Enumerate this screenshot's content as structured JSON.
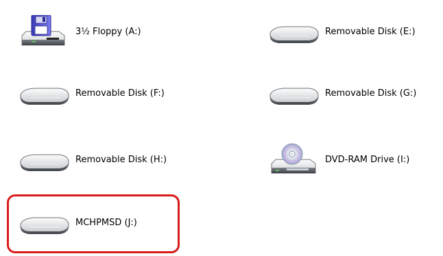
{
  "drives": [
    {
      "id": "a",
      "label": "3½ Floppy (A:)",
      "icon": "floppy-drive-icon"
    },
    {
      "id": "e",
      "label": "Removable Disk (E:)",
      "icon": "removable-disk-icon"
    },
    {
      "id": "f",
      "label": "Removable Disk (F:)",
      "icon": "removable-disk-icon"
    },
    {
      "id": "g",
      "label": "Removable Disk (G:)",
      "icon": "removable-disk-icon"
    },
    {
      "id": "h",
      "label": "Removable Disk (H:)",
      "icon": "removable-disk-icon"
    },
    {
      "id": "i",
      "label": "DVD-RAM Drive (I:)",
      "icon": "dvd-drive-icon"
    },
    {
      "id": "j",
      "label": "MCHPMSD (J:)",
      "icon": "removable-disk-icon"
    }
  ],
  "colors": {
    "highlight": "#d81a1a",
    "floppy": "#5b5bd6",
    "disk": "#9ea3a8"
  }
}
